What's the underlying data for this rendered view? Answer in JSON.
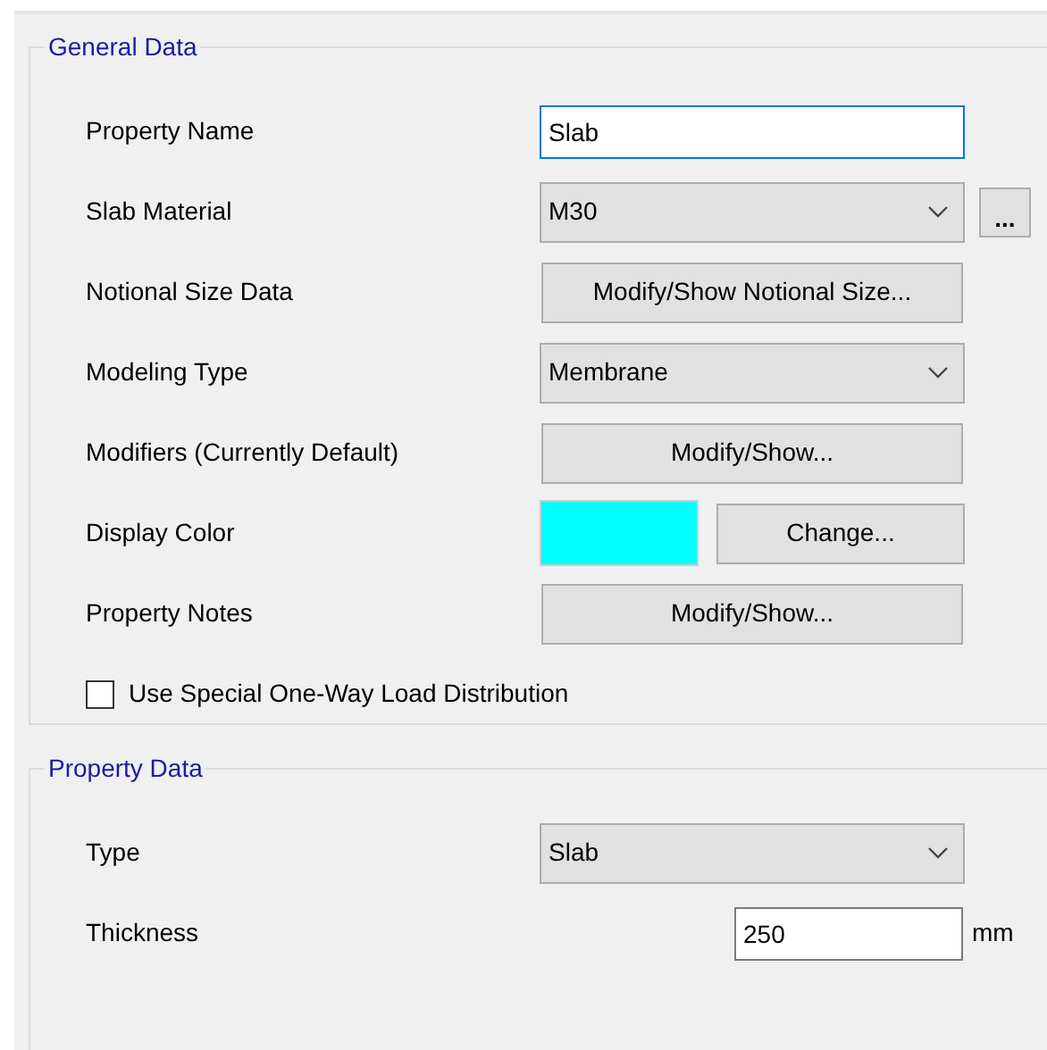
{
  "sections": [
    {
      "title": "General Data",
      "rows": [
        {
          "kind": "text",
          "label": "Property Name",
          "value": "Slab",
          "focused": true
        },
        {
          "kind": "dropdown",
          "label": "Slab Material",
          "value": "M30",
          "extra_button": "..."
        },
        {
          "kind": "button",
          "label": "Notional Size Data",
          "button": "Modify/Show Notional Size..."
        },
        {
          "kind": "dropdown",
          "label": "Modeling Type",
          "value": "Membrane"
        },
        {
          "kind": "button",
          "label": "Modifiers (Currently Default)",
          "button": "Modify/Show..."
        },
        {
          "kind": "color",
          "label": "Display Color",
          "color": "#00ffff",
          "button": "Change..."
        },
        {
          "kind": "button",
          "label": "Property Notes",
          "button": "Modify/Show..."
        },
        {
          "kind": "checkbox",
          "label": "Use Special One-Way Load Distribution",
          "checked": false
        }
      ]
    },
    {
      "title": "Property Data",
      "rows": [
        {
          "kind": "dropdown",
          "label": "Type",
          "value": "Slab"
        },
        {
          "kind": "number",
          "label": "Thickness",
          "value": "250",
          "unit": "mm",
          "focused": false
        }
      ]
    }
  ]
}
